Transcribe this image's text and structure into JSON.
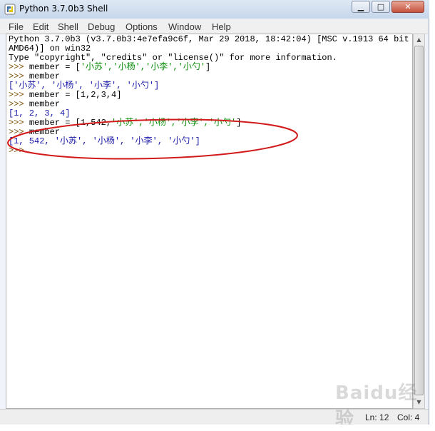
{
  "window": {
    "title": "Python 3.7.0b3 Shell"
  },
  "menu": [
    "File",
    "Edit",
    "Shell",
    "Debug",
    "Options",
    "Window",
    "Help"
  ],
  "shell": {
    "banner1": "Python 3.7.0b3 (v3.7.0b3:4e7efa9c6f, Mar 29 2018, 18:42:04) [MSC v.1913 64 bit (",
    "banner2": "AMD64)] on win32",
    "banner3": "Type \"copyright\", \"credits\" or \"license()\" for more information.",
    "prompt": ">>> ",
    "l1_code_a": "member = [",
    "l1_strings": "'小苏','小杨','小李','小勺'",
    "l1_code_b": "]",
    "l2_code": "member",
    "l2_out": "['小苏', '小杨', '小李', '小勺']",
    "l3_code": "member = [1,2,3,4]",
    "l4_code": "member",
    "l4_out": "[1, 2, 3, 4]",
    "l5_code_a": "member = [1,542,",
    "l5_strings": "'小苏','小杨','小李','小勺'",
    "l5_code_b": "]",
    "l6_code": "member",
    "l6_out": "[1, 542, '小苏', '小杨', '小李', '小勺']",
    "final_prompt": ">>>"
  },
  "status": {
    "line": "Ln: 12",
    "col": "Col: 4"
  },
  "watermark": "Baidu经验",
  "colors": {
    "output": "#1a1aa8",
    "string": "#0a8f0a",
    "prompt": "#7a4d00",
    "annotation": "#d21a1a"
  },
  "icons": {
    "app": "python-idle-icon",
    "minimize": "minimize-icon",
    "maximize": "maximize-icon",
    "close": "close-icon"
  }
}
